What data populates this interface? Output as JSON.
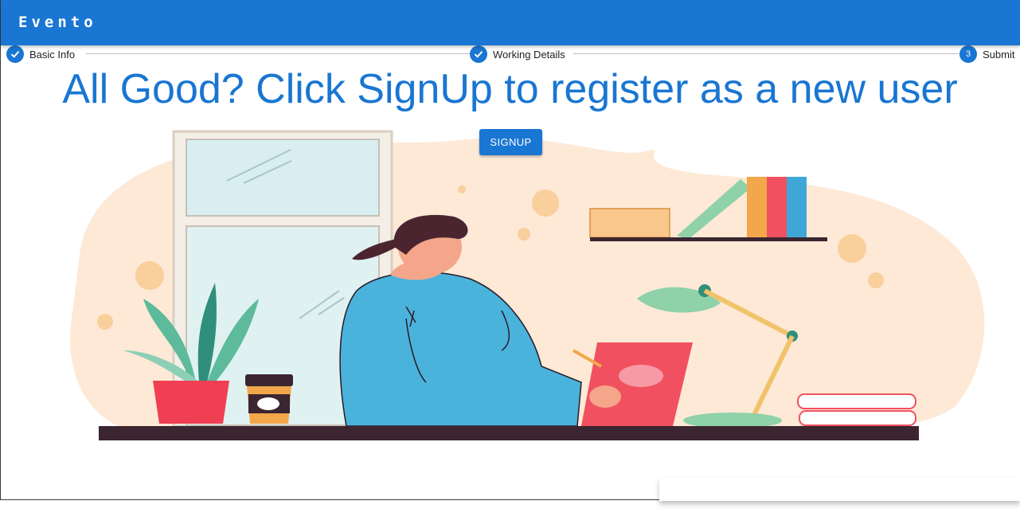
{
  "app": {
    "title": "Evento"
  },
  "stepper": {
    "steps": [
      {
        "label": "Basic Info",
        "state": "completed",
        "icon": "check-icon"
      },
      {
        "label": "Working Details",
        "state": "completed",
        "icon": "check-icon"
      },
      {
        "label": "Submit",
        "state": "active",
        "number": "3"
      }
    ]
  },
  "main": {
    "headline": "All Good? Click SignUp to register as a new user",
    "signup_label": "SIGNUP"
  },
  "colors": {
    "primary": "#1976d2",
    "background": "#ffffff"
  },
  "illustration": {
    "subject": "woman-at-desk-illustration"
  }
}
